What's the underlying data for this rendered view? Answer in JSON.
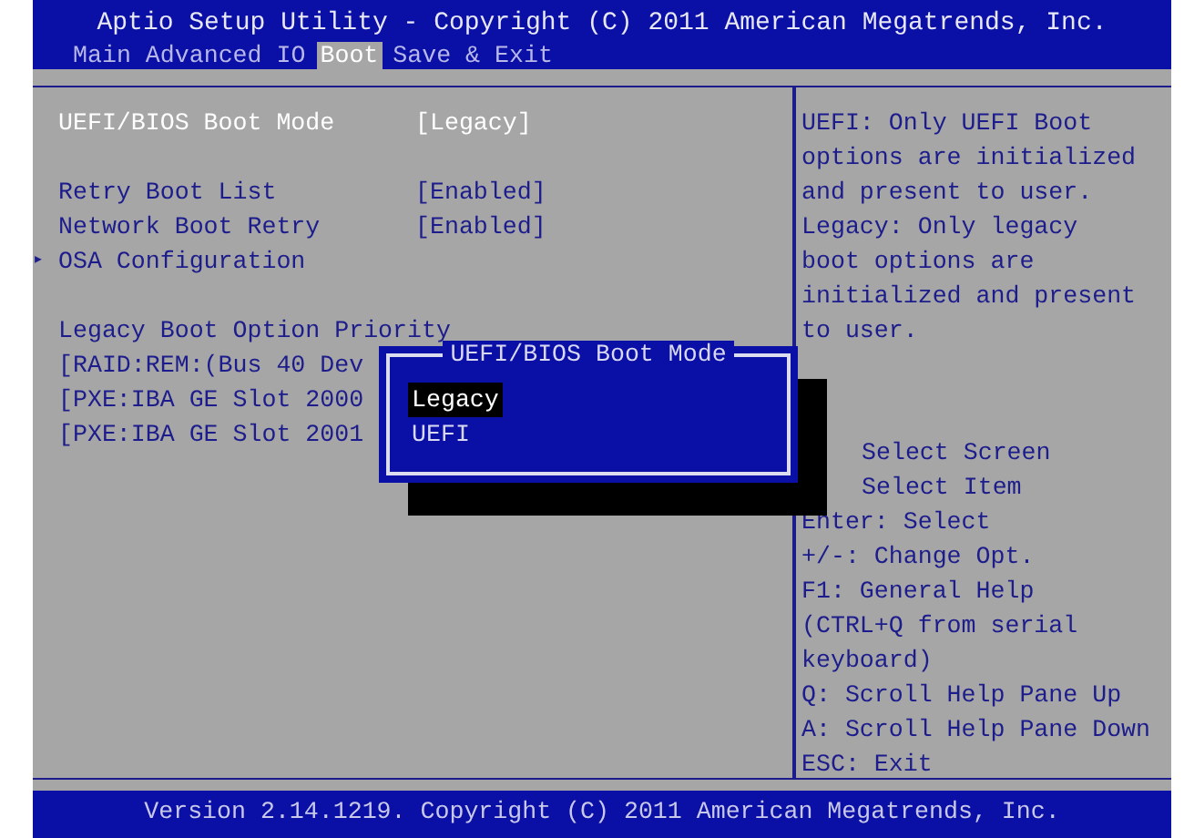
{
  "header": {
    "title": "Aptio Setup Utility - Copyright (C) 2011 American Megatrends, Inc."
  },
  "tabs": [
    {
      "label": "Main",
      "selected": false
    },
    {
      "label": "Advanced",
      "selected": false
    },
    {
      "label": "IO",
      "selected": false
    },
    {
      "label": "Boot",
      "selected": true
    },
    {
      "label": "Save & Exit",
      "selected": false
    }
  ],
  "groups": [
    [
      {
        "kind": "option",
        "label": "UEFI/BIOS Boot Mode",
        "value": "[Legacy]",
        "selected": true
      }
    ],
    [
      {
        "kind": "option",
        "label": "Retry Boot List",
        "value": "[Enabled]",
        "selected": false
      },
      {
        "kind": "option",
        "label": "Network Boot Retry",
        "value": "[Enabled]",
        "selected": false
      },
      {
        "kind": "submenu",
        "label": "OSA Configuration",
        "marker": "▸",
        "selected": false
      }
    ],
    [
      {
        "kind": "heading",
        "label": "Legacy Boot Option Priority",
        "selected": false
      },
      {
        "kind": "option",
        "label": "[RAID:REM:(Bus 40 Dev",
        "selected": false
      },
      {
        "kind": "option",
        "label": "[PXE:IBA GE Slot 2000",
        "selected": false
      },
      {
        "kind": "option",
        "label": "[PXE:IBA GE Slot 2001",
        "selected": false
      }
    ]
  ],
  "help": {
    "description": [
      "UEFI: Only UEFI Boot",
      "options are initialized",
      "and present to user.",
      "Legacy: Only legacy",
      "boot options are",
      "initialized and present",
      "to user."
    ],
    "keys": [
      {
        "kind": "covered",
        "text": "Select Screen"
      },
      {
        "kind": "covered",
        "text": "Select Item"
      },
      {
        "kind": "line",
        "text": "Enter: Select"
      },
      {
        "kind": "line",
        "text": "+/-: Change Opt."
      },
      {
        "kind": "line",
        "text": "F1: General Help"
      },
      {
        "kind": "line",
        "text": "(CTRL+Q from serial"
      },
      {
        "kind": "line",
        "text": "keyboard)"
      },
      {
        "kind": "line",
        "text": "Q: Scroll Help Pane Up"
      },
      {
        "kind": "line",
        "text": "A: Scroll Help Pane Down"
      },
      {
        "kind": "line",
        "text": "ESC: Exit"
      }
    ]
  },
  "popup": {
    "title": "UEFI/BIOS Boot Mode",
    "options": [
      {
        "label": "Legacy",
        "selected": true
      },
      {
        "label": "UEFI",
        "selected": false
      }
    ]
  },
  "footer": {
    "text": "Version 2.14.1219. Copyright (C) 2011 American Megatrends, Inc."
  }
}
